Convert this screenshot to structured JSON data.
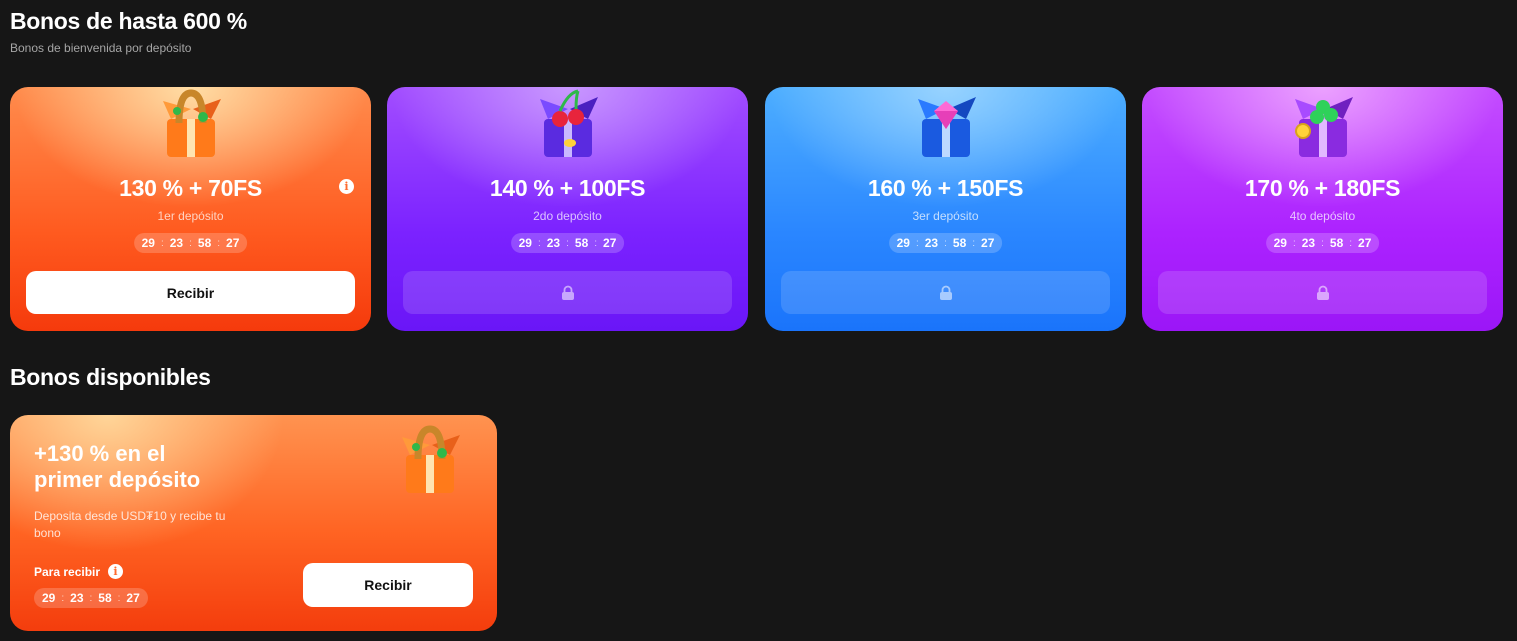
{
  "header": {
    "title": "Bonos de hasta 600 %",
    "subtitle": "Bonos de bienvenida por depósito"
  },
  "cards": [
    {
      "amount": "130 % + 70FS",
      "deposit": "1er depósito",
      "timer": [
        "29",
        "23",
        "58",
        "27"
      ],
      "button_label": "Recibir",
      "locked": false,
      "theme": "orange",
      "gift_icon": "horseshoe-gift-icon"
    },
    {
      "amount": "140 % + 100FS",
      "deposit": "2do depósito",
      "timer": [
        "29",
        "23",
        "58",
        "27"
      ],
      "locked": true,
      "theme": "violet",
      "gift_icon": "cherry-gift-icon"
    },
    {
      "amount": "160 % + 150FS",
      "deposit": "3er depósito",
      "timer": [
        "29",
        "23",
        "58",
        "27"
      ],
      "locked": true,
      "theme": "blue",
      "gift_icon": "diamond-gift-icon"
    },
    {
      "amount": "170 % + 180FS",
      "deposit": "4to depósito",
      "timer": [
        "29",
        "23",
        "58",
        "27"
      ],
      "locked": true,
      "theme": "purple",
      "gift_icon": "clover-gift-icon"
    }
  ],
  "available": {
    "title": "Bonos disponibles",
    "bonus": {
      "title": "+130 % en el primer depósito",
      "description": "Deposita desde USD₮10 y recibe tu bono",
      "label": "Para recibir",
      "timer": [
        "29",
        "23",
        "58",
        "27"
      ],
      "button_label": "Recibir"
    }
  },
  "colors": {
    "background": "#161616",
    "orange": "#ff5a1f",
    "violet": "#7b22ff",
    "blue": "#2a86ff",
    "purple": "#ac22ff"
  }
}
